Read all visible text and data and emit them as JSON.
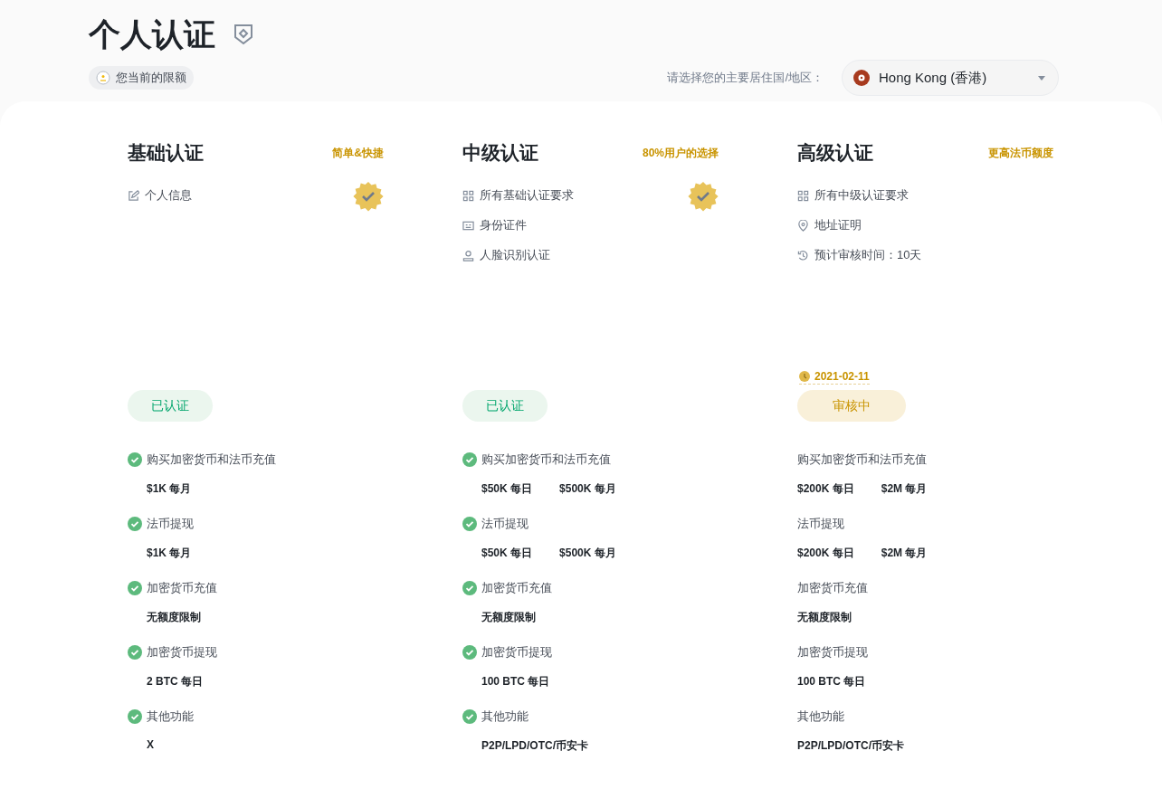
{
  "page": {
    "title": "个人认证",
    "limits_chip": "您当前的限额",
    "region_label": "请选择您的主要居住国/地区：",
    "region_value": "Hong Kong (香港)"
  },
  "tiers": [
    {
      "title": "基础认证",
      "tagline": "简单&快捷",
      "verified": true,
      "requirements": [
        {
          "kind": "edit",
          "text": "个人信息"
        }
      ],
      "status": {
        "kind": "verified",
        "label": "已认证"
      },
      "limits": [
        {
          "label": "购买加密货币和法币充值",
          "checked": true,
          "values": [
            "$1K 每月"
          ]
        },
        {
          "label": "法币提现",
          "checked": true,
          "values": [
            "$1K 每月"
          ]
        },
        {
          "label": "加密货币充值",
          "checked": true,
          "values": [
            "无额度限制"
          ]
        },
        {
          "label": "加密货币提现",
          "checked": true,
          "values": [
            "2 BTC 每日"
          ]
        },
        {
          "label": "其他功能",
          "checked": true,
          "values": [
            "X"
          ]
        }
      ]
    },
    {
      "title": "中级认证",
      "tagline": "80%用户的选择",
      "verified": true,
      "requirements": [
        {
          "kind": "grid",
          "text": "所有基础认证要求"
        },
        {
          "kind": "id",
          "text": "身份证件"
        },
        {
          "kind": "face",
          "text": "人脸识别认证"
        }
      ],
      "status": {
        "kind": "verified",
        "label": "已认证"
      },
      "limits": [
        {
          "label": "购买加密货币和法币充值",
          "checked": true,
          "values": [
            "$50K 每日",
            "$500K 每月"
          ]
        },
        {
          "label": "法币提现",
          "checked": true,
          "values": [
            "$50K 每日",
            "$500K 每月"
          ]
        },
        {
          "label": "加密货币充值",
          "checked": true,
          "values": [
            "无额度限制"
          ]
        },
        {
          "label": "加密货币提现",
          "checked": true,
          "values": [
            "100 BTC 每日"
          ]
        },
        {
          "label": "其他功能",
          "checked": true,
          "values": [
            "P2P/LPD/OTC/币安卡"
          ]
        }
      ]
    },
    {
      "title": "高级认证",
      "tagline": "更高法币额度",
      "verified": false,
      "requirements": [
        {
          "kind": "grid",
          "text": "所有中级认证要求"
        },
        {
          "kind": "address",
          "text": "地址证明"
        },
        {
          "kind": "time",
          "text": "预计审核时间：10天"
        }
      ],
      "date": "2021-02-11",
      "status": {
        "kind": "pending",
        "label": "审核中"
      },
      "limits": [
        {
          "label": "购买加密货币和法币充值",
          "checked": false,
          "values": [
            "$200K 每日",
            "$2M 每月"
          ]
        },
        {
          "label": "法币提现",
          "checked": false,
          "values": [
            "$200K 每日",
            "$2M 每月"
          ]
        },
        {
          "label": "加密货币充值",
          "checked": false,
          "values": [
            "无额度限制"
          ]
        },
        {
          "label": "加密货币提现",
          "checked": false,
          "values": [
            "100 BTC 每日"
          ]
        },
        {
          "label": "其他功能",
          "checked": false,
          "values": [
            "P2P/LPD/OTC/币安卡"
          ]
        }
      ]
    }
  ]
}
